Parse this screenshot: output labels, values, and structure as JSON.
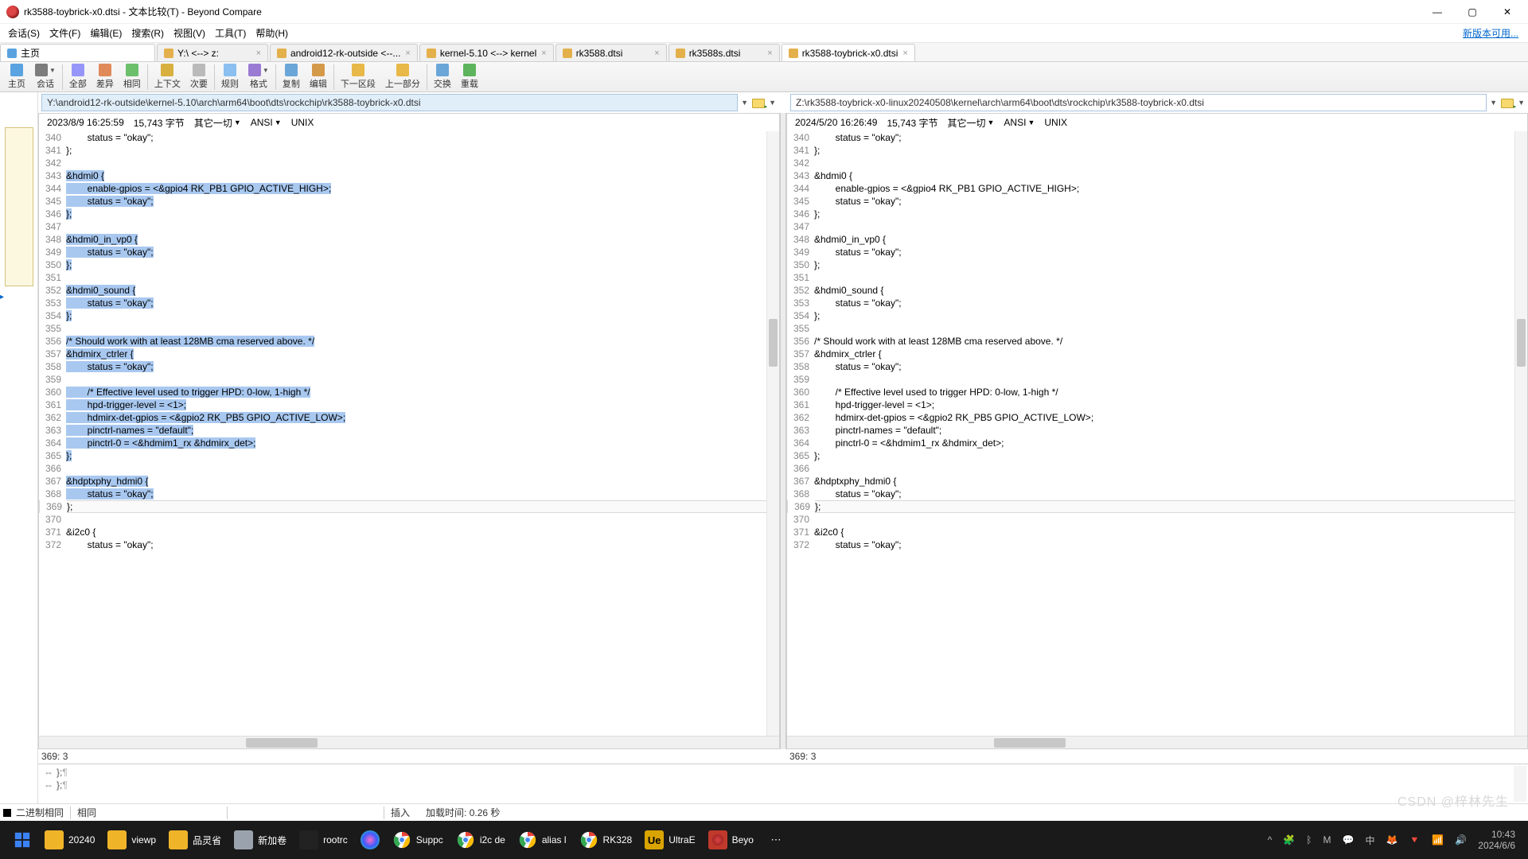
{
  "title": "rk3588-toybrick-x0.dtsi - 文本比较(T) - Beyond Compare",
  "menubar": [
    "会话(S)",
    "文件(F)",
    "编辑(E)",
    "搜索(R)",
    "视图(V)",
    "工具(T)",
    "帮助(H)"
  ],
  "menubar_right": "新版本可用...",
  "tabs": [
    {
      "label": "主页",
      "icon": "home"
    },
    {
      "label": "Y:\\ <--> z:",
      "close": true
    },
    {
      "label": "android12-rk-outside <--...",
      "close": true
    },
    {
      "label": "kernel-5.10 <--> kernel",
      "close": true
    },
    {
      "label": "rk3588.dtsi",
      "close": true
    },
    {
      "label": "rk3588s.dtsi",
      "close": true
    },
    {
      "label": "rk3588-toybrick-x0.dtsi",
      "close": true,
      "active": true
    }
  ],
  "toolbar": [
    {
      "label": "主页",
      "icon": "home",
      "sep": false
    },
    {
      "label": "会话",
      "icon": "sessions",
      "drop": true,
      "sep": true
    },
    {
      "label": "全部",
      "icon": "all"
    },
    {
      "label": "差异",
      "icon": "diff"
    },
    {
      "label": "相同",
      "icon": "same",
      "sep": true
    },
    {
      "label": "上下文",
      "icon": "ctx"
    },
    {
      "label": "次要",
      "icon": "minor",
      "sep": true
    },
    {
      "label": "规则",
      "icon": "rules"
    },
    {
      "label": "格式",
      "icon": "format",
      "drop": true,
      "sep": true
    },
    {
      "label": "复制",
      "icon": "copy"
    },
    {
      "label": "编辑",
      "icon": "edit",
      "sep": true
    },
    {
      "label": "下一区段",
      "icon": "next"
    },
    {
      "label": "上一部分",
      "icon": "prev",
      "sep": true
    },
    {
      "label": "交换",
      "icon": "swap"
    },
    {
      "label": "重载",
      "icon": "reload"
    }
  ],
  "left": {
    "path": "Y:\\android12-rk-outside\\kernel-5.10\\arch\\arm64\\boot\\dts\\rockchip\\rk3588-toybrick-x0.dtsi",
    "timestamp": "2023/8/9 16:25:59",
    "size": "15,743 字节",
    "misc": "其它一切",
    "enc": "ANSI",
    "eol": "UNIX",
    "status": "369: 3",
    "lines": [
      {
        "n": 340,
        "t": "        status = \"okay\";"
      },
      {
        "n": 341,
        "t": "};"
      },
      {
        "n": 342,
        "t": ""
      },
      {
        "n": 343,
        "t": "&hdmi0 {",
        "sel": true,
        "marker": true
      },
      {
        "n": 344,
        "t": "        enable-gpios = <&gpio4 RK_PB1 GPIO_ACTIVE_HIGH>;",
        "sel": true
      },
      {
        "n": 345,
        "t": "        status = \"okay\";",
        "sel": true
      },
      {
        "n": 346,
        "t": "};",
        "sel": true
      },
      {
        "n": 347,
        "t": "",
        "sel": false
      },
      {
        "n": 348,
        "t": "&hdmi0_in_vp0 {",
        "sel": true
      },
      {
        "n": 349,
        "t": "        status = \"okay\";",
        "sel": true
      },
      {
        "n": 350,
        "t": "};",
        "sel": true
      },
      {
        "n": 351,
        "t": ""
      },
      {
        "n": 352,
        "t": "&hdmi0_sound {",
        "sel": true
      },
      {
        "n": 353,
        "t": "        status = \"okay\";",
        "sel": true
      },
      {
        "n": 354,
        "t": "};",
        "sel": true
      },
      {
        "n": 355,
        "t": ""
      },
      {
        "n": 356,
        "t": "/* Should work with at least 128MB cma reserved above. */",
        "sel": true
      },
      {
        "n": 357,
        "t": "&hdmirx_ctrler {",
        "sel": true
      },
      {
        "n": 358,
        "t": "        status = \"okay\";",
        "sel": true
      },
      {
        "n": 359,
        "t": "",
        "sel": true
      },
      {
        "n": 360,
        "t": "        /* Effective level used to trigger HPD: 0-low, 1-high */",
        "sel": true
      },
      {
        "n": 361,
        "t": "        hpd-trigger-level = <1>;",
        "sel": true
      },
      {
        "n": 362,
        "t": "        hdmirx-det-gpios = <&gpio2 RK_PB5 GPIO_ACTIVE_LOW>;",
        "sel": true
      },
      {
        "n": 363,
        "t": "        pinctrl-names = \"default\";",
        "sel": true
      },
      {
        "n": 364,
        "t": "        pinctrl-0 = <&hdmim1_rx &hdmirx_det>;",
        "sel": true
      },
      {
        "n": 365,
        "t": "};",
        "sel": true
      },
      {
        "n": 366,
        "t": ""
      },
      {
        "n": 367,
        "t": "&hdptxphy_hdmi0 {",
        "sel": true
      },
      {
        "n": 368,
        "t": "        status = \"okay\";",
        "sel": true
      },
      {
        "n": 369,
        "t": "};",
        "cursor": true
      },
      {
        "n": 370,
        "t": ""
      },
      {
        "n": 371,
        "t": "&i2c0 {"
      },
      {
        "n": 372,
        "t": "        status = \"okay\";"
      }
    ]
  },
  "right": {
    "path": "Z:\\rk3588-toybrick-x0-linux20240508\\kernel\\arch\\arm64\\boot\\dts\\rockchip\\rk3588-toybrick-x0.dtsi",
    "timestamp": "2024/5/20 16:26:49",
    "size": "15,743 字节",
    "misc": "其它一切",
    "enc": "ANSI",
    "eol": "UNIX",
    "status": "369: 3",
    "lines": [
      {
        "n": 340,
        "t": "        status = \"okay\";"
      },
      {
        "n": 341,
        "t": "};"
      },
      {
        "n": 342,
        "t": ""
      },
      {
        "n": 343,
        "t": "&hdmi0 {"
      },
      {
        "n": 344,
        "t": "        enable-gpios = <&gpio4 RK_PB1 GPIO_ACTIVE_HIGH>;"
      },
      {
        "n": 345,
        "t": "        status = \"okay\";"
      },
      {
        "n": 346,
        "t": "};"
      },
      {
        "n": 347,
        "t": ""
      },
      {
        "n": 348,
        "t": "&hdmi0_in_vp0 {"
      },
      {
        "n": 349,
        "t": "        status = \"okay\";"
      },
      {
        "n": 350,
        "t": "};"
      },
      {
        "n": 351,
        "t": ""
      },
      {
        "n": 352,
        "t": "&hdmi0_sound {"
      },
      {
        "n": 353,
        "t": "        status = \"okay\";"
      },
      {
        "n": 354,
        "t": "};"
      },
      {
        "n": 355,
        "t": ""
      },
      {
        "n": 356,
        "t": "/* Should work with at least 128MB cma reserved above. */"
      },
      {
        "n": 357,
        "t": "&hdmirx_ctrler {"
      },
      {
        "n": 358,
        "t": "        status = \"okay\";"
      },
      {
        "n": 359,
        "t": ""
      },
      {
        "n": 360,
        "t": "        /* Effective level used to trigger HPD: 0-low, 1-high */"
      },
      {
        "n": 361,
        "t": "        hpd-trigger-level = <1>;"
      },
      {
        "n": 362,
        "t": "        hdmirx-det-gpios = <&gpio2 RK_PB5 GPIO_ACTIVE_LOW>;"
      },
      {
        "n": 363,
        "t": "        pinctrl-names = \"default\";"
      },
      {
        "n": 364,
        "t": "        pinctrl-0 = <&hdmim1_rx &hdmirx_det>;"
      },
      {
        "n": 365,
        "t": "};"
      },
      {
        "n": 366,
        "t": ""
      },
      {
        "n": 367,
        "t": "&hdptxphy_hdmi0 {"
      },
      {
        "n": 368,
        "t": "        status = \"okay\";"
      },
      {
        "n": 369,
        "t": "};",
        "cursor": true
      },
      {
        "n": 370,
        "t": ""
      },
      {
        "n": 371,
        "t": "&i2c0 {"
      },
      {
        "n": 372,
        "t": "        status = \"okay\";"
      }
    ]
  },
  "bottompanel": {
    "line1": "};",
    "line2": "};"
  },
  "statusbar": {
    "left": "二进制相同",
    "same": "相同",
    "insert": "插入",
    "load": "加载时间: 0.26 秒"
  },
  "taskbar": [
    {
      "label": "",
      "icon": "win",
      "color": "#3b82f6"
    },
    {
      "label": "20240",
      "icon": "folder",
      "color": "#f0b429"
    },
    {
      "label": "viewp",
      "icon": "folder",
      "color": "#f0b429"
    },
    {
      "label": "品灵省",
      "icon": "folder",
      "color": "#f0b429"
    },
    {
      "label": "新加卷",
      "icon": "drive",
      "color": "#9aa3ad"
    },
    {
      "label": "rootrc",
      "icon": "term",
      "color": "#222"
    },
    {
      "label": "",
      "icon": "paint",
      "color": "#3b5bff"
    },
    {
      "label": "Suppc",
      "icon": "chrome",
      "color": ""
    },
    {
      "label": "i2c de",
      "icon": "chrome",
      "color": ""
    },
    {
      "label": "alias l",
      "icon": "chrome",
      "color": ""
    },
    {
      "label": "RK328",
      "icon": "chrome",
      "color": ""
    },
    {
      "label": "UltraE",
      "icon": "ue",
      "color": "#d9a400"
    },
    {
      "label": "Beyo",
      "icon": "bc",
      "color": "#c0392b"
    },
    {
      "label": "",
      "icon": "more",
      "color": ""
    }
  ],
  "tray": {
    "items": [
      "^",
      "🧩",
      "ᛒ",
      "M",
      "💬",
      "中",
      "🦊",
      "🔻",
      "📶",
      "🔊"
    ],
    "time": "10:43",
    "date": "2024/6/6"
  },
  "watermark": "CSDN @梓林先生"
}
